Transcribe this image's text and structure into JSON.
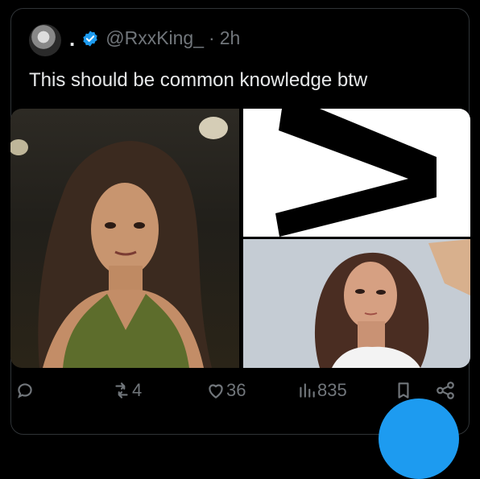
{
  "tweet": {
    "display_name": ".",
    "handle": "@RxxKing_",
    "separator": "·",
    "time": "2h",
    "text": "This should be common knowledge btw"
  },
  "actions": {
    "replies": "",
    "retweets": "4",
    "likes": "36",
    "views": "835"
  },
  "colors": {
    "background": "#000000",
    "text": "#e7e9ea",
    "muted": "#71767b",
    "accent": "#1d9bf0"
  }
}
